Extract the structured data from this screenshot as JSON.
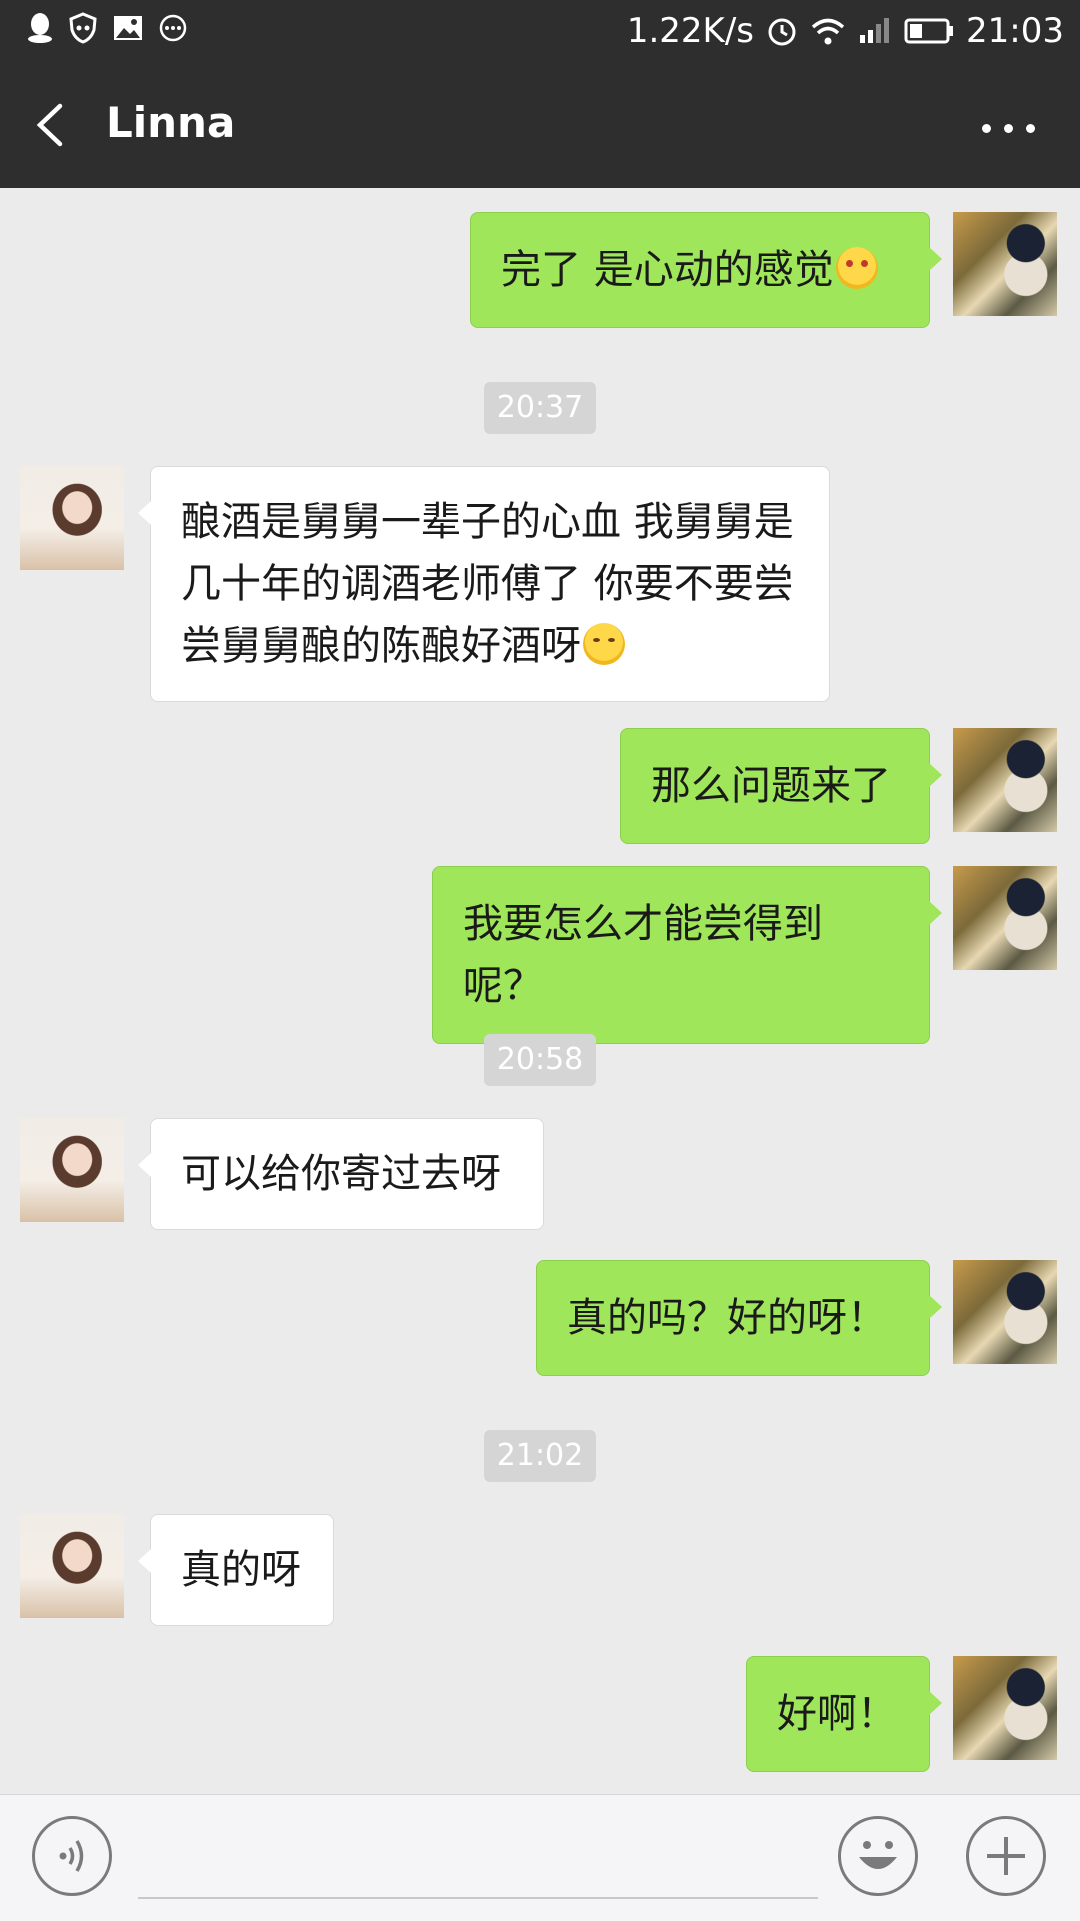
{
  "status_bar": {
    "network_speed": "1.22K/s",
    "time": "21:03",
    "icons": [
      "qq-icon",
      "shield-icon",
      "image-icon",
      "more-circle-icon",
      "alarm-icon",
      "wifi-icon",
      "signal-icon",
      "battery-icon"
    ]
  },
  "header": {
    "title": "Linna"
  },
  "messages": [
    {
      "side": "right",
      "text": "完了 是心动的感觉",
      "emoji": "heart-eyes-emoji"
    },
    {
      "timestamp": "20:37"
    },
    {
      "side": "left",
      "text": "酿酒是舅舅一辈子的心血 我舅舅是几十年的调酒老师傅了 你要不要尝尝舅舅酿的陈酿好酒呀",
      "emoji": "smile-emoji"
    },
    {
      "side": "right",
      "text": "那么问题来了"
    },
    {
      "side": "right",
      "text": "我要怎么才能尝得到呢？"
    },
    {
      "timestamp": "20:58"
    },
    {
      "side": "left",
      "text": "可以给你寄过去呀"
    },
    {
      "side": "right",
      "text": "真的吗？好的呀！"
    },
    {
      "timestamp": "21:02"
    },
    {
      "side": "left",
      "text": "真的呀"
    },
    {
      "side": "right",
      "text": "好啊！"
    }
  ],
  "input": {
    "value": ""
  },
  "colors": {
    "bar": "#2e2e2e",
    "background": "#ebebeb",
    "outgoing_bubble": "#9fe65a",
    "incoming_bubble": "#ffffff"
  }
}
